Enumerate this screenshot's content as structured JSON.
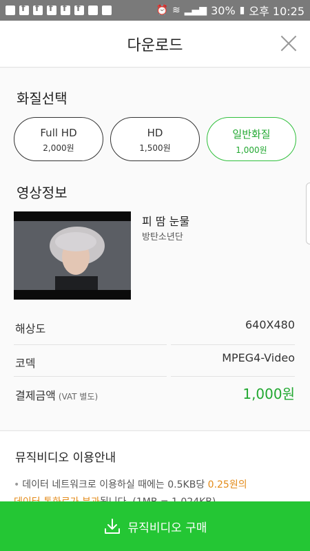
{
  "status_bar": {
    "battery": "30%",
    "time": "오후 10:25"
  },
  "header": {
    "title": "다운로드"
  },
  "quality_select": {
    "title": "화질선택",
    "options": [
      {
        "name": "Full HD",
        "price": "2,000원",
        "selected": false
      },
      {
        "name": "HD",
        "price": "1,500원",
        "selected": false
      },
      {
        "name": "일반화질",
        "price": "1,000원",
        "selected": true
      }
    ]
  },
  "video_info": {
    "title": "영상정보",
    "song": "피 땀 눈물",
    "artist": "방탄소년단",
    "resolution_label": "해상도",
    "resolution_value": "640X480",
    "codec_label": "코덱",
    "codec_value": "MPEG4-Video",
    "price_label": "결제금액",
    "price_note": "(VAT 별도)",
    "price_value": "1,000원"
  },
  "notice": {
    "title": "뮤직비디오 이용안내",
    "line1_prefix": "데이터 네트워크로 이용하실 때에는 0.5KB당",
    "line1_highlight": "0.25원의",
    "line2_highlight": "데이터 통화료가 부과",
    "line2_suffix": "됩니다. (1MB = 1,024KB)"
  },
  "buy_button": {
    "label": "뮤직비디오 구매"
  },
  "colors": {
    "accent": "#24c634",
    "highlight": "#e38a18"
  }
}
